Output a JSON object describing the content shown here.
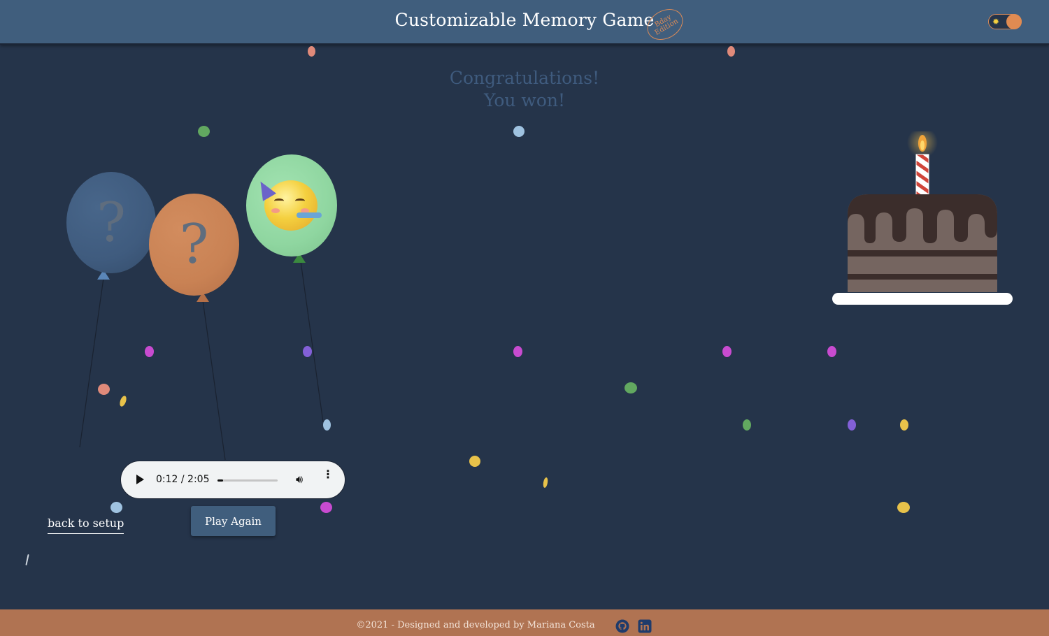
{
  "header": {
    "title": "Customizable Memory Game",
    "stamp_line1": "Bday",
    "stamp_line2": "Edition",
    "theme_toggle_icon": "sun-icon"
  },
  "main": {
    "congrats_line1": "Congratulations!",
    "congrats_line2": "You won!",
    "balloons": [
      {
        "content": "?",
        "color": "#405e7d"
      },
      {
        "content": "?",
        "color": "#c98254"
      },
      {
        "content": "partying-face-emoji",
        "color": "#8fd6a0"
      }
    ],
    "audio": {
      "time": "0:12 / 2:05",
      "progress": 0.096
    },
    "back_link": "back to setup",
    "play_again": "Play Again"
  },
  "footer": {
    "copyright": "©2021 - Designed and developed by Mariana Costa",
    "icons": [
      "github-icon",
      "linkedin-icon"
    ]
  },
  "colors": {
    "background": "#25344a",
    "header": "#405e7d",
    "footer": "#b07352",
    "accent": "#e08b52"
  }
}
